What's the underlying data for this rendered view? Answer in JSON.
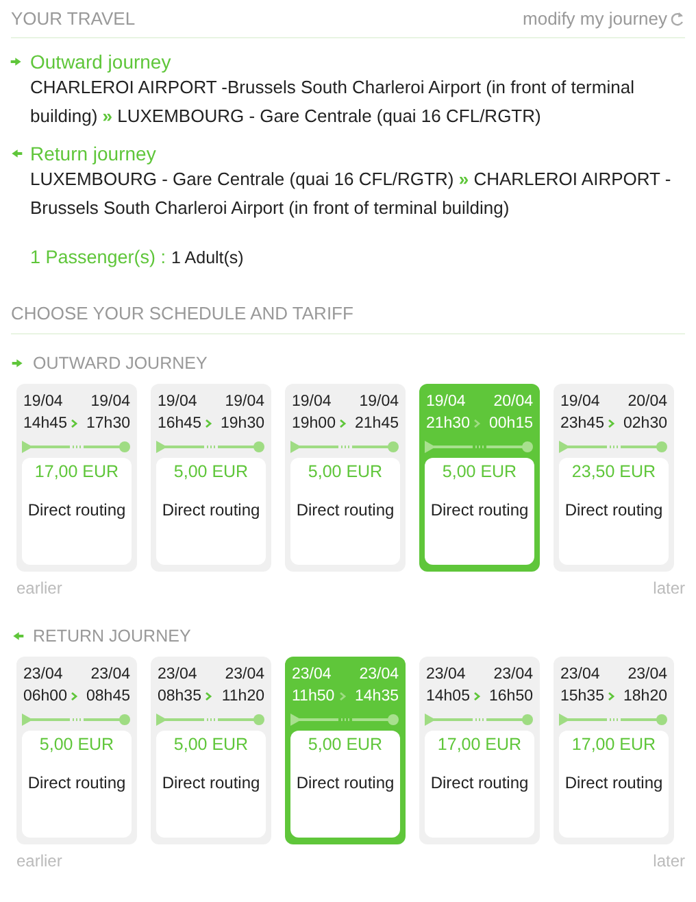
{
  "travel": {
    "title": "YOUR TRAVEL",
    "modify_link": "modify my journey",
    "journeys": [
      {
        "kind": "outward",
        "label": "Outward journey",
        "from": "CHARLEROI AIRPORT -Brussels South Charleroi Airport (in front of terminal building)",
        "separator": "»",
        "to": "LUXEMBOURG - Gare Centrale (quai 16 CFL/RGTR)"
      },
      {
        "kind": "return",
        "label": "Return journey",
        "from": "LUXEMBOURG - Gare Centrale (quai 16 CFL/RGTR)",
        "separator": "»",
        "to": "CHARLEROI AIRPORT - Brussels South Charleroi Airport (in front of terminal building)"
      }
    ],
    "passengers_label": "1 Passenger(s) :",
    "passengers_value": "1 Adult(s)"
  },
  "schedule": {
    "title": "CHOOSE YOUR SCHEDULE AND TARIFF",
    "sections": [
      {
        "kind": "outward",
        "title": "OUTWARD JOURNEY",
        "earlier": "earlier",
        "later": "later",
        "trips": [
          {
            "depart_date": "19/04",
            "depart_time": "14h45",
            "arrive_date": "19/04",
            "arrive_time": "17h30",
            "price": "17,00 EUR",
            "routing": "Direct routing",
            "selected": false
          },
          {
            "depart_date": "19/04",
            "depart_time": "16h45",
            "arrive_date": "19/04",
            "arrive_time": "19h30",
            "price": "5,00 EUR",
            "routing": "Direct routing",
            "selected": false
          },
          {
            "depart_date": "19/04",
            "depart_time": "19h00",
            "arrive_date": "19/04",
            "arrive_time": "21h45",
            "price": "5,00 EUR",
            "routing": "Direct routing",
            "selected": false
          },
          {
            "depart_date": "19/04",
            "depart_time": "21h30",
            "arrive_date": "20/04",
            "arrive_time": "00h15",
            "price": "5,00 EUR",
            "routing": "Direct routing",
            "selected": true
          },
          {
            "depart_date": "19/04",
            "depart_time": "23h45",
            "arrive_date": "20/04",
            "arrive_time": "02h30",
            "price": "23,50 EUR",
            "routing": "Direct routing",
            "selected": false
          }
        ]
      },
      {
        "kind": "return",
        "title": "RETURN JOURNEY",
        "earlier": "earlier",
        "later": "later",
        "trips": [
          {
            "depart_date": "23/04",
            "depart_time": "06h00",
            "arrive_date": "23/04",
            "arrive_time": "08h45",
            "price": "5,00 EUR",
            "routing": "Direct routing",
            "selected": false
          },
          {
            "depart_date": "23/04",
            "depart_time": "08h35",
            "arrive_date": "23/04",
            "arrive_time": "11h20",
            "price": "5,00 EUR",
            "routing": "Direct routing",
            "selected": false
          },
          {
            "depart_date": "23/04",
            "depart_time": "11h50",
            "arrive_date": "23/04",
            "arrive_time": "14h35",
            "price": "5,00 EUR",
            "routing": "Direct routing",
            "selected": true
          },
          {
            "depart_date": "23/04",
            "depart_time": "14h05",
            "arrive_date": "23/04",
            "arrive_time": "16h50",
            "price": "17,00 EUR",
            "routing": "Direct routing",
            "selected": false
          },
          {
            "depart_date": "23/04",
            "depart_time": "15h35",
            "arrive_date": "23/04",
            "arrive_time": "18h20",
            "price": "17,00 EUR",
            "routing": "Direct routing",
            "selected": false
          }
        ]
      }
    ]
  }
}
